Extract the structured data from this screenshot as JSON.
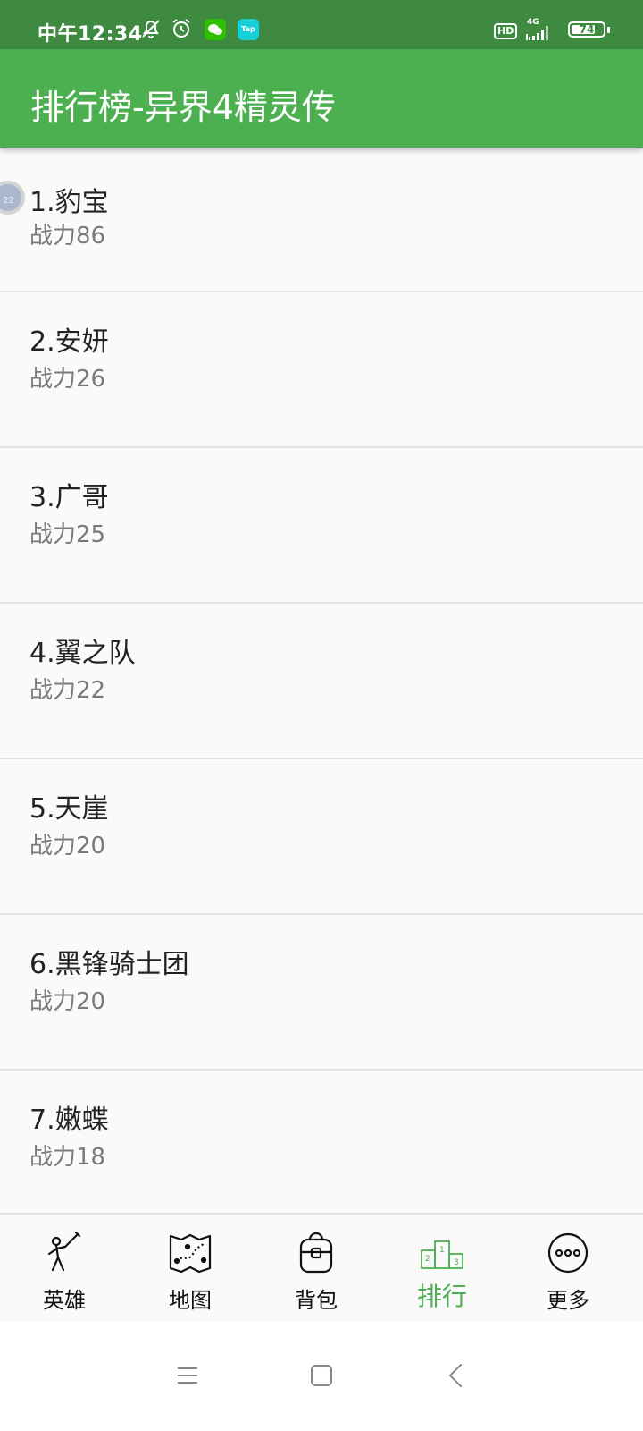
{
  "status_bar": {
    "time": "中午12:34",
    "tap_label": "Tap",
    "hd": "HD",
    "network": "4G",
    "battery": "74"
  },
  "app_bar": {
    "title": "排行榜-异界4精灵传"
  },
  "floating_badge": "22",
  "rankings": [
    {
      "name": "1.豹宝",
      "power": "战力86"
    },
    {
      "name": "2.安妍",
      "power": "战力26"
    },
    {
      "name": "3.广哥",
      "power": "战力25"
    },
    {
      "name": "4.翼之队",
      "power": "战力22"
    },
    {
      "name": "5.天崖",
      "power": "战力20"
    },
    {
      "name": "6.黑锋骑士团",
      "power": "战力20"
    },
    {
      "name": "7.嫩蝶",
      "power": "战力18"
    }
  ],
  "bottom_nav": [
    {
      "label": "英雄",
      "icon": "swordsman-icon"
    },
    {
      "label": "地图",
      "icon": "map-icon"
    },
    {
      "label": "背包",
      "icon": "backpack-icon"
    },
    {
      "label": "排行",
      "icon": "podium-icon",
      "active": true
    },
    {
      "label": "更多",
      "icon": "more-dots-icon"
    }
  ],
  "colors": {
    "status_bar": "#3e8a41",
    "app_bar": "#4caf50",
    "active": "#4caf50"
  }
}
